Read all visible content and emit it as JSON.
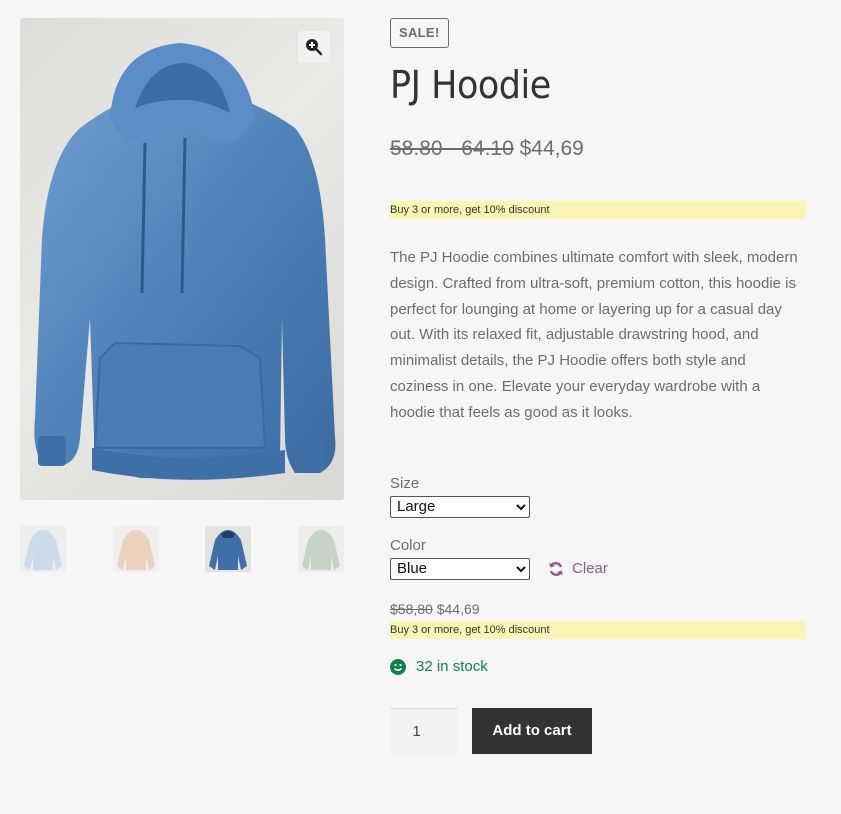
{
  "gallery": {
    "main_image_alt": "PJ Hoodie - Blue",
    "zoom_icon": "magnifier-plus-icon",
    "thumbnails": [
      {
        "label": "Light Blue hoodie",
        "color": "#a9c6df",
        "active": false
      },
      {
        "label": "Peach hoodie",
        "color": "#e6b48f",
        "active": false
      },
      {
        "label": "Blue hoodie",
        "color": "#3f6fa6",
        "active": true
      },
      {
        "label": "Sage Green hoodie",
        "color": "#9fb8a0",
        "active": false
      }
    ]
  },
  "product": {
    "badge": "SALE!",
    "title": "PJ Hoodie",
    "price_range_old": "58.80 - 64.10",
    "price_current": "$44,69",
    "discount_note": "Buy 3 or more, get 10% discount",
    "description": "The PJ Hoodie combines ultimate comfort with sleek, modern design. Crafted from ultra-soft, premium cotton, this hoodie is perfect for lounging at home or layering up for a casual day out. With its relaxed fit, adjustable drawstring hood, and minimalist details, the PJ Hoodie offers both style and coziness in one. Elevate your everyday wardrobe with a hoodie that feels as good as it looks."
  },
  "variations": {
    "size_label": "Size",
    "size_selected": "Large",
    "color_label": "Color",
    "color_selected": "Blue",
    "clear_label": "Clear",
    "clear_icon": "refresh-icon"
  },
  "variation_info": {
    "price_old": "$58,80",
    "price_new": "$44,69",
    "discount_note": "Buy 3 or more, get 10% discount",
    "stock_text": "32 in stock",
    "stock_icon": "smile-icon"
  },
  "cart": {
    "quantity": "1",
    "add_to_cart_label": "Add to cart"
  },
  "colors": {
    "background": "#f6f6f6",
    "accent_link": "#96588a",
    "stock_green": "#0f834d",
    "note_yellow": "#fbf5b4",
    "button_dark": "#333333"
  }
}
